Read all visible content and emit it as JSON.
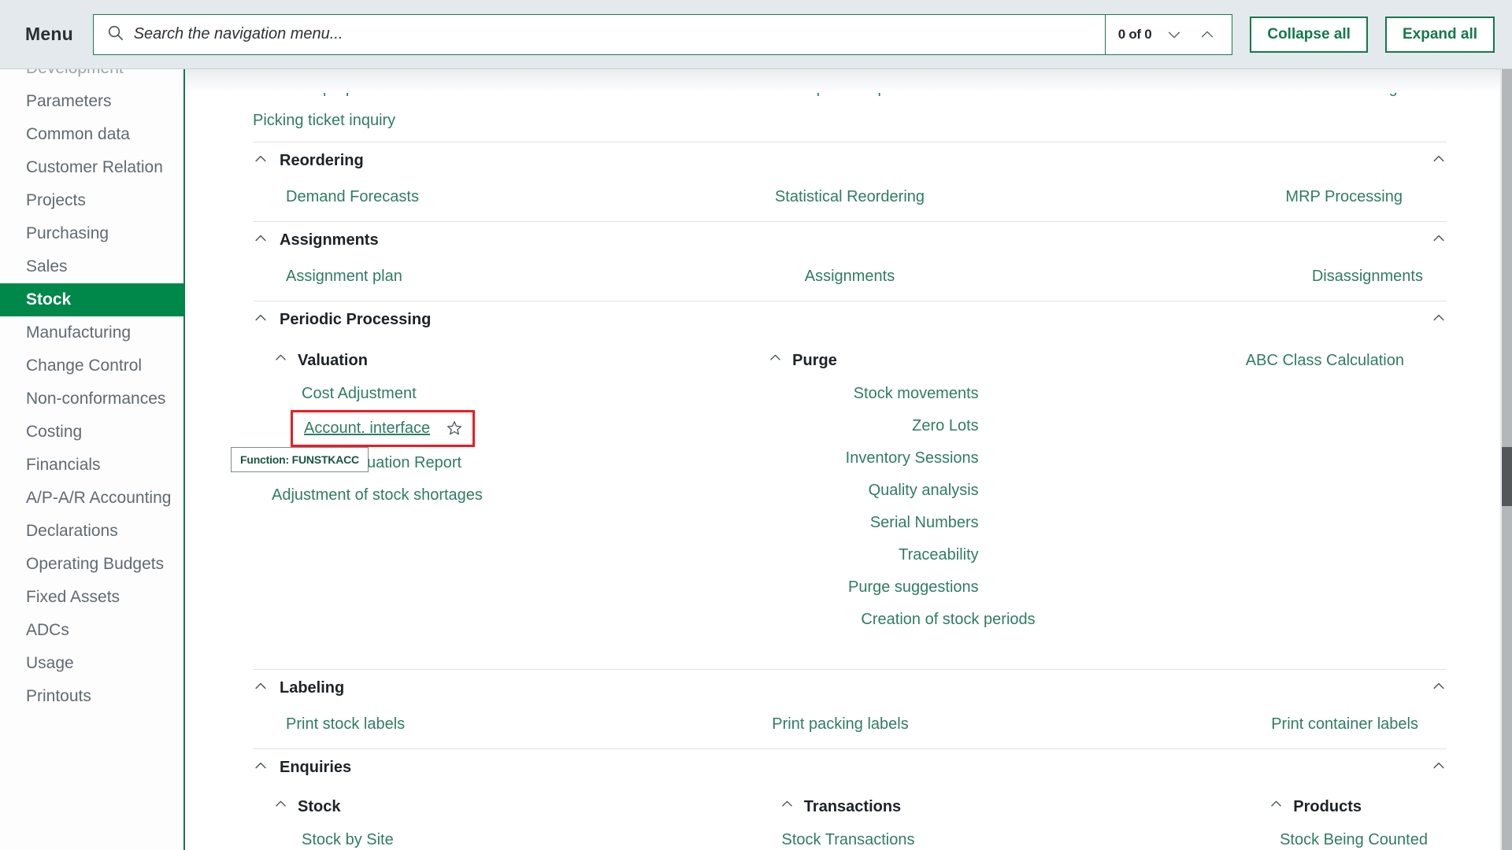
{
  "header": {
    "menu_label": "Menu",
    "search_placeholder": "Search the navigation menu...",
    "search_value": "",
    "match_count": "0 of 0",
    "collapse_all_label": "Collapse all",
    "expand_all_label": "Expand all"
  },
  "sidebar": {
    "items": [
      {
        "label": "Development",
        "selected": false,
        "clipped": true
      },
      {
        "label": "Parameters",
        "selected": false
      },
      {
        "label": "Common data",
        "selected": false
      },
      {
        "label": "Customer Relation",
        "selected": false
      },
      {
        "label": "Projects",
        "selected": false
      },
      {
        "label": "Purchasing",
        "selected": false
      },
      {
        "label": "Sales",
        "selected": false
      },
      {
        "label": "Stock",
        "selected": true
      },
      {
        "label": "Manufacturing",
        "selected": false
      },
      {
        "label": "Change Control",
        "selected": false
      },
      {
        "label": "Non-conformances",
        "selected": false
      },
      {
        "label": "Costing",
        "selected": false
      },
      {
        "label": "Financials",
        "selected": false
      },
      {
        "label": "A/P-A/R Accounting",
        "selected": false
      },
      {
        "label": "Declarations",
        "selected": false
      },
      {
        "label": "Operating Budgets",
        "selected": false
      },
      {
        "label": "Fixed Assets",
        "selected": false
      },
      {
        "label": "ADCs",
        "selected": false
      },
      {
        "label": "Usage",
        "selected": false
      },
      {
        "label": "Printouts",
        "selected": false
      }
    ]
  },
  "content": {
    "partial_top": {
      "row1": [
        "Generate preparation lists",
        "Preparation plan",
        "Picking tickets"
      ],
      "row2": [
        "Picking ticket inquiry",
        "",
        ""
      ]
    },
    "reordering": {
      "title": "Reordering",
      "row1": [
        "Demand Forecasts",
        "Statistical Reordering",
        "MRP Processing"
      ]
    },
    "assignments": {
      "title": "Assignments",
      "row1": [
        "Assignment plan",
        "Assignments",
        "Disassignments"
      ]
    },
    "periodic_processing": {
      "title": "Periodic Processing",
      "valuation": {
        "title": "Valuation",
        "items": [
          "Cost Adjustment",
          "Account. interface",
          "Stock Valuation Report",
          "Adjustment of stock shortages"
        ],
        "highlighted_item": "Account. interface",
        "tooltip": "Function: FUNSTKACC"
      },
      "purge": {
        "title": "Purge",
        "items": [
          "Stock movements",
          "Zero Lots",
          "Inventory Sessions",
          "Quality analysis",
          "Serial Numbers",
          "Traceability",
          "Purge suggestions",
          "Creation of stock periods"
        ]
      },
      "third_col": [
        "ABC Class Calculation"
      ]
    },
    "labeling": {
      "title": "Labeling",
      "row1": [
        "Print stock labels",
        "Print packing labels",
        "Print container labels"
      ]
    },
    "enquiries": {
      "title": "Enquiries",
      "groups": [
        {
          "title": "Stock",
          "items": [
            "Stock by Site"
          ]
        },
        {
          "title": "Transactions",
          "items": [
            "Stock Transactions"
          ]
        },
        {
          "title": "Products",
          "items": [
            "Stock Being Counted"
          ]
        }
      ]
    }
  },
  "colors": {
    "accent_green": "#13794a",
    "selected_green": "#00884a",
    "link_green": "#2f7d62",
    "highlight_red": "#ef1b20",
    "header_bg": "#e3e9ec"
  }
}
